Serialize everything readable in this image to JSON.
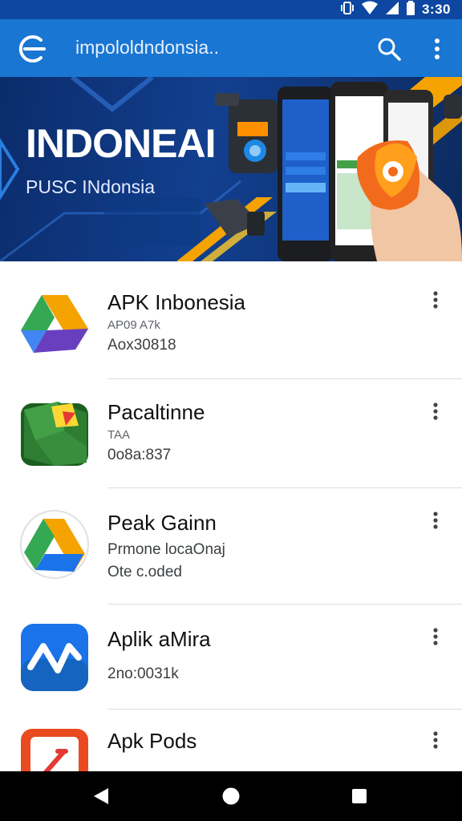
{
  "status_bar": {
    "time": "3:30"
  },
  "app_bar": {
    "title": "impololdndonsia..",
    "icons": [
      "back-icon",
      "search-icon",
      "more-vert-icon"
    ]
  },
  "banner": {
    "title": "INDONEAI",
    "subtitle": "PUSC INdonsia"
  },
  "apps": [
    {
      "name": "APK Inbonesia",
      "meta1": "AP09 A7k",
      "meta2": "Aox30818",
      "icon": "drive-triangle-icon"
    },
    {
      "name": "Pacaltinne",
      "meta1": "TAA",
      "meta2": "0o8a:837",
      "icon": "green-map-icon"
    },
    {
      "name": "Peak Gainn",
      "meta1": "Prmone locaOnaj",
      "meta2": "Ote c.oded",
      "icon": "drive-circle-icon"
    },
    {
      "name": "Aplik aMira",
      "meta1": "",
      "meta2": "2no:0031k",
      "icon": "blue-wave-icon"
    },
    {
      "name": "Apk Pods",
      "meta1": "",
      "meta2": "",
      "icon": "red-square-icon"
    }
  ],
  "colors": {
    "status_bar": "#0d47a1",
    "app_bar": "#1976d2",
    "banner_bg": "#123f8f",
    "accent_orange": "#f4a300",
    "nav_bar": "#000000"
  },
  "nav": {
    "icons": [
      "back-triangle-icon",
      "home-circle-icon",
      "recents-square-icon"
    ]
  }
}
